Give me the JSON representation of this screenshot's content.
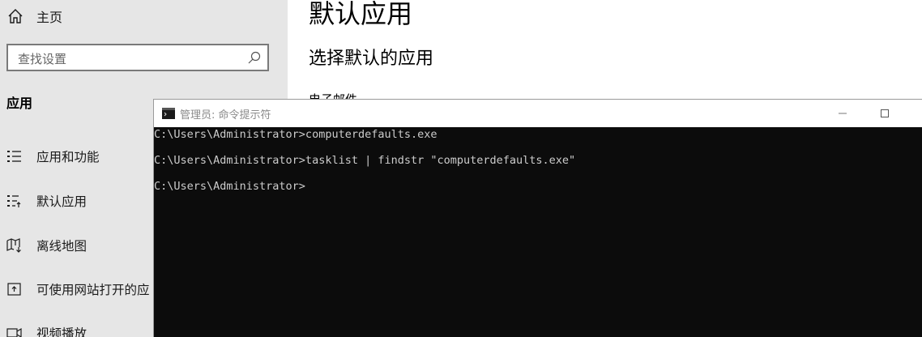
{
  "settings": {
    "nav": {
      "home_label": "主页",
      "search_placeholder": "查找设置",
      "section_title": "应用",
      "items": [
        {
          "label": "应用和功能",
          "icon": "list-icon"
        },
        {
          "label": "默认应用",
          "icon": "default-apps-icon"
        },
        {
          "label": "离线地图",
          "icon": "map-icon"
        },
        {
          "label": "可使用网站打开的应",
          "icon": "open-web-icon"
        },
        {
          "label": "视频播放",
          "icon": "video-icon"
        }
      ]
    },
    "main": {
      "page_title": "默认应用",
      "sub_title": "选择默认的应用",
      "partial_label": "电子邮件"
    }
  },
  "cmd_window": {
    "title": "管理员: 命令提示符",
    "lines": [
      "C:\\Users\\Administrator>computerdefaults.exe",
      "C:\\Users\\Administrator>tasklist | findstr \"computerdefaults.exe\"",
      "C:\\Users\\Administrator>"
    ],
    "colors": {
      "background": "#0c0c0c",
      "text": "#cccccc",
      "titlebar": "#ffffff"
    }
  }
}
